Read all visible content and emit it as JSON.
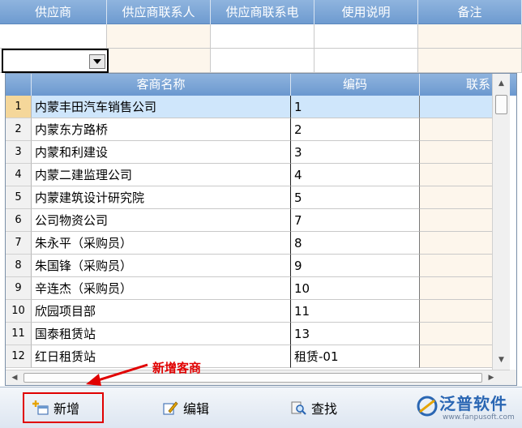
{
  "grid": {
    "columns": [
      "供应商",
      "供应商联系人",
      "供应商联系电",
      "使用说明",
      "备注"
    ]
  },
  "dropdown": {
    "columns": [
      "客商名称",
      "编码",
      "联系"
    ],
    "rows": [
      {
        "num": "1",
        "name": "内蒙丰田汽车销售公司",
        "code": "1",
        "selected": true
      },
      {
        "num": "2",
        "name": "内蒙东方路桥",
        "code": "2"
      },
      {
        "num": "3",
        "name": "内蒙和利建设",
        "code": "3"
      },
      {
        "num": "4",
        "name": "内蒙二建监理公司",
        "code": "4"
      },
      {
        "num": "5",
        "name": "内蒙建筑设计研究院",
        "code": "5"
      },
      {
        "num": "6",
        "name": "公司物资公司",
        "code": "7"
      },
      {
        "num": "7",
        "name": "朱永平（采购员）",
        "code": "8"
      },
      {
        "num": "8",
        "name": "朱国锋（采购员）",
        "code": "9"
      },
      {
        "num": "9",
        "name": "辛连杰（采购员）",
        "code": "10"
      },
      {
        "num": "10",
        "name": "欣园项目部",
        "code": "11"
      },
      {
        "num": "11",
        "name": "国泰租赁站",
        "code": "13"
      },
      {
        "num": "12",
        "name": "红日租赁站",
        "code": "租赁-01"
      }
    ]
  },
  "annotation": {
    "text": "新增客商",
    "color": "#e10000"
  },
  "toolbar": {
    "add_label": "新增",
    "edit_label": "编辑",
    "find_label": "查找"
  },
  "brand": {
    "name": "泛普软件",
    "url": "www.fanpusoft.com"
  },
  "colors": {
    "header_blue": "#7aa5d6",
    "selected_row": "#cfe6fb",
    "tint_column": "#fdf6ec",
    "highlight_red": "#e00000"
  }
}
